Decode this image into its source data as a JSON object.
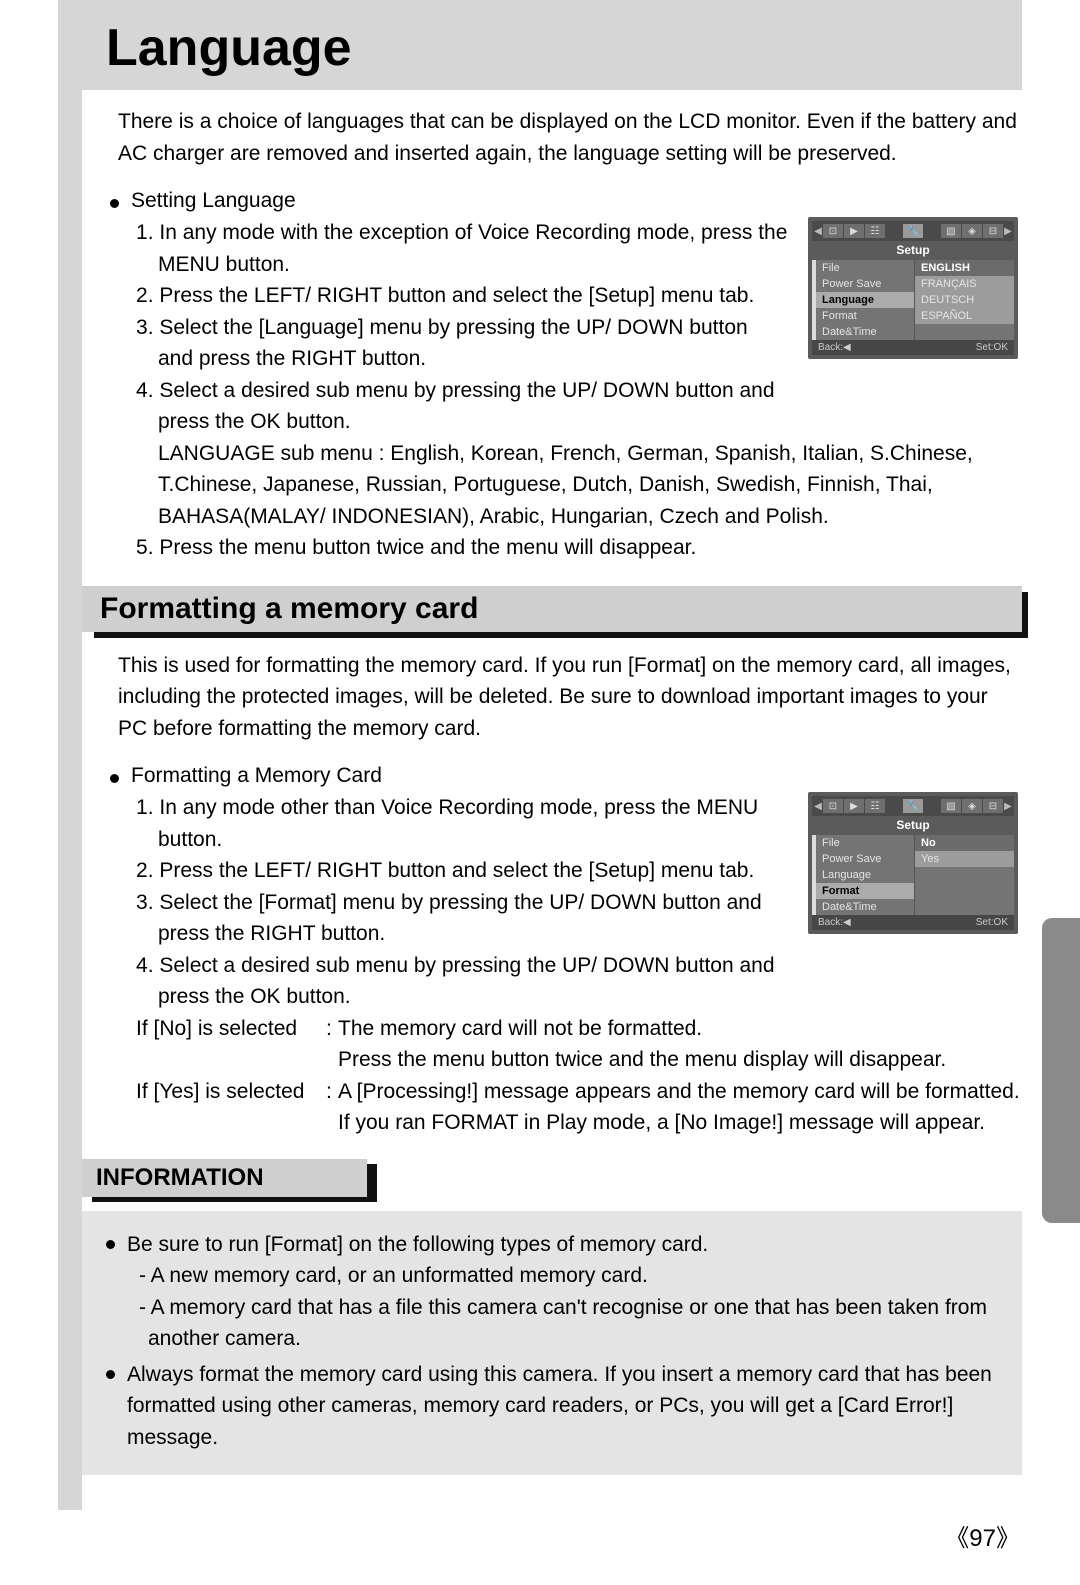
{
  "title": "Language",
  "intro": "There is a choice of languages that can be displayed on the LCD monitor. Even if the battery and AC charger are removed and inserted again, the language setting will be preserved.",
  "section1": {
    "bullet": "Setting Language",
    "steps": [
      "In any mode with the exception of Voice Recording mode, press the MENU button.",
      "Press the LEFT/ RIGHT button and select the [Setup] menu tab.",
      "Select the [Language] menu by pressing the UP/ DOWN button and press the RIGHT button.",
      "Select a desired sub menu by pressing the UP/ DOWN button and press the OK button."
    ],
    "langnote": "LANGUAGE sub menu : English, Korean, French, German, Spanish, Italian, S.Chinese, T.Chinese, Japanese, Russian, Portuguese, Dutch, Danish, Swedish, Finnish, Thai, BAHASA(MALAY/ INDONESIAN), Arabic, Hungarian, Czech and Polish.",
    "step5": "Press the menu button twice and the menu will disappear."
  },
  "section2": {
    "heading": "Formatting a memory card",
    "intro": "This is used for formatting the memory card. If you run [Format] on the memory card, all images, including the protected images, will be deleted. Be sure to download important images to your PC before formatting the memory card.",
    "bullet": "Formatting a Memory Card",
    "steps": [
      "In any mode other than Voice Recording mode, press the MENU button.",
      "Press the LEFT/ RIGHT button and select the [Setup] menu tab.",
      "Select the [Format] menu by pressing the UP/ DOWN button and press the RIGHT button.",
      "Select a desired sub menu by pressing the UP/ DOWN button and press the OK button."
    ],
    "no_label": "If [No] is selected",
    "no_val1": "The memory card will not be formatted.",
    "no_val2": "Press the menu button twice and the menu display will disappear.",
    "yes_label": "If [Yes] is selected",
    "yes_val": "A [Processing!] message appears and the memory card will be formatted. If you ran FORMAT in Play mode, a [No Image!] message will appear."
  },
  "info": {
    "heading": "INFORMATION",
    "b1": "Be sure to run [Format] on the following types of memory card.",
    "b1a": "- A new memory card, or an unformatted memory card.",
    "b1b": "- A memory card that has a file this camera can't recognise or one that has been taken from another camera.",
    "b2": "Always format the memory card using this camera. If you insert a memory card that has been formatted using other cameras, memory card readers, or PCs, you will get a [Card Error!] message."
  },
  "lcd1": {
    "setup": "Setup",
    "menu": [
      "File",
      "Power Save",
      "Language",
      "Format",
      "Date&Time"
    ],
    "selected_menu": "Language",
    "vals": [
      "ENGLISH",
      "FRANÇAIS",
      "DEUTSCH",
      "ESPAÑOL"
    ],
    "selected_val": "ENGLISH",
    "back": "Back:◀",
    "set": "Set:OK"
  },
  "lcd2": {
    "setup": "Setup",
    "menu": [
      "File",
      "Power Save",
      "Language",
      "Format",
      "Date&Time"
    ],
    "selected_menu": "Format",
    "vals": [
      "No",
      "Yes"
    ],
    "selected_val": "No",
    "back": "Back:◀",
    "set": "Set:OK"
  },
  "pagenum": "《97》"
}
